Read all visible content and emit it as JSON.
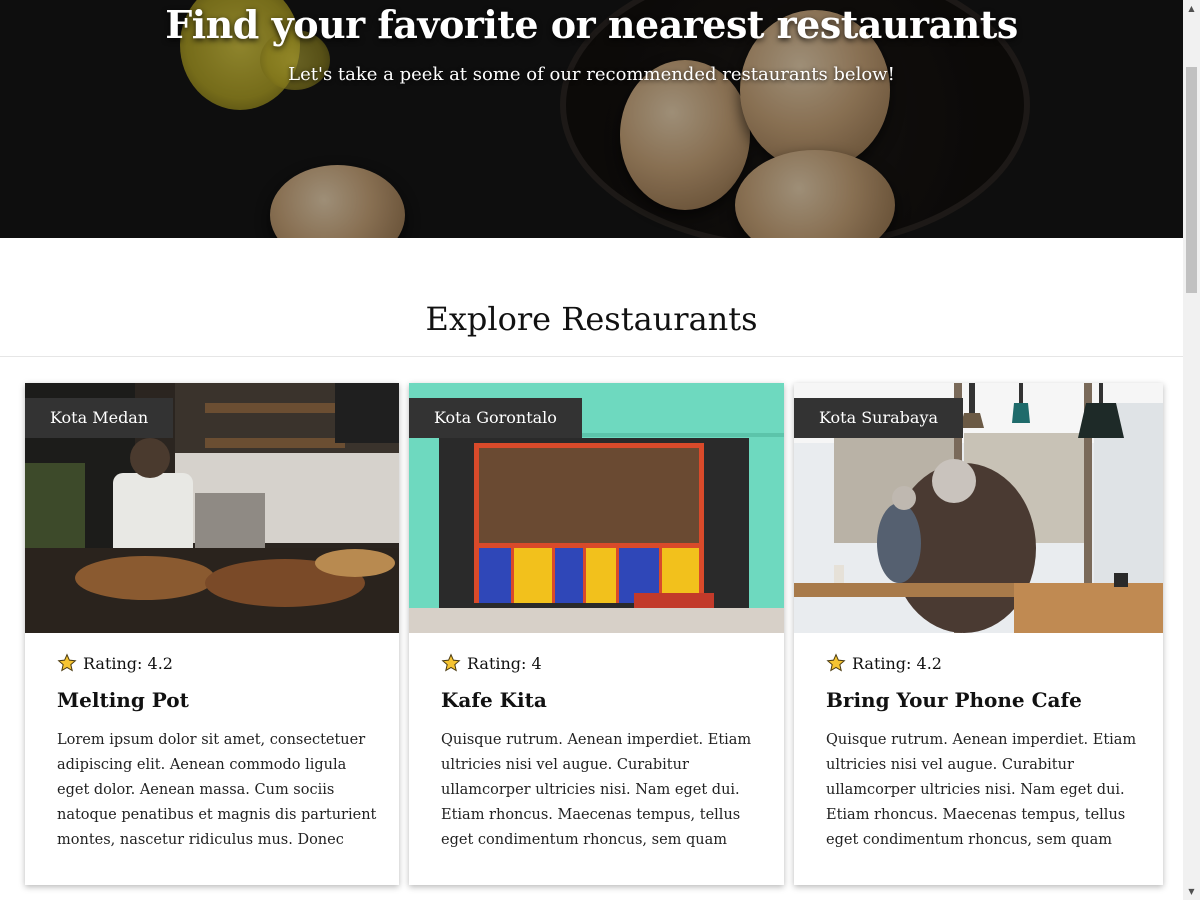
{
  "hero": {
    "title": "Find your favorite or nearest restaurants",
    "subtitle": "Let's take a peek at some of our recommended restaurants below!"
  },
  "section": {
    "title": "Explore Restaurants"
  },
  "restaurants": [
    {
      "city": "Kota Medan",
      "rating_label": "Rating: 4.2",
      "name": "Melting Pot",
      "description": "Lorem ipsum dolor sit amet, consectetuer adipiscing elit. Aenean commodo ligula eget dolor. Aenean massa. Cum sociis natoque penatibus et magnis dis parturient montes, nascetur ridiculus mus. Donec quam felis,..."
    },
    {
      "city": "Kota Gorontalo",
      "rating_label": "Rating: 4",
      "name": "Kafe Kita",
      "description": "Quisque rutrum. Aenean imperdiet. Etiam ultricies nisi vel augue. Curabitur ullamcorper ultricies nisi. Nam eget dui. Etiam rhoncus. Maecenas tempus, tellus eget condimentum rhoncus, sem quam semper libero, sit amet..."
    },
    {
      "city": "Kota Surabaya",
      "rating_label": "Rating: 4.2",
      "name": "Bring Your Phone Cafe",
      "description": "Quisque rutrum. Aenean imperdiet. Etiam ultricies nisi vel augue. Curabitur ullamcorper ultricies nisi. Nam eget dui. Etiam rhoncus. Maecenas tempus, tellus eget condimentum rhoncus, sem quam semper libero, sit amet..."
    }
  ],
  "icons": {
    "star": "star-icon",
    "scroll_up": "scroll-up-arrow-icon",
    "scroll_down": "scroll-down-arrow-icon"
  },
  "colors": {
    "badge_bg": "#333333",
    "star_fill": "#f6c431",
    "hero_bg": "#151515"
  }
}
